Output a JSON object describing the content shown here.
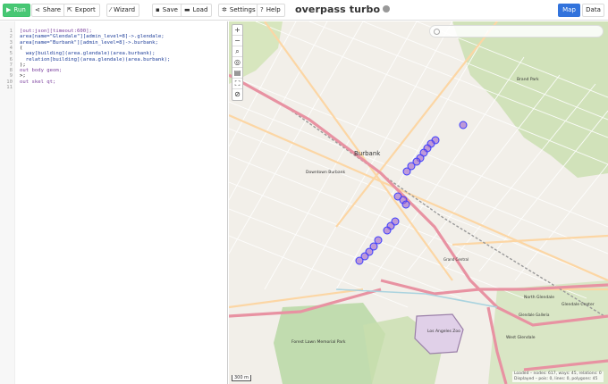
{
  "toolbar": {
    "run": "Run",
    "share": "Share",
    "export": "Export",
    "wizard": "Wizard",
    "save": "Save",
    "load": "Load",
    "settings": "Settings",
    "help": "Help",
    "brand": "overpass turbo",
    "tab_map": "Map",
    "tab_data": "Data"
  },
  "editor": {
    "lines": [
      {
        "n": "1",
        "text": "[out:json][timeout:600];"
      },
      {
        "n": "2",
        "text": "area[name=\"Glendale\"][admin_level=8]->.glendale;"
      },
      {
        "n": "3",
        "text": "area[name=\"Burbank\"][admin_level=8]->.burbank;"
      },
      {
        "n": "4",
        "text": "("
      },
      {
        "n": "5",
        "text": "  way[building](area.glendale)(area.burbank);"
      },
      {
        "n": "6",
        "text": "  relation[building](area.glendale)(area.burbank);"
      },
      {
        "n": "7",
        "text": ");"
      },
      {
        "n": "8",
        "text": "out body geom;"
      },
      {
        "n": "9",
        "text": ">;"
      },
      {
        "n": "10",
        "text": "out skel qt;"
      },
      {
        "n": "11",
        "text": ""
      }
    ]
  },
  "map": {
    "search_placeholder": "",
    "scale": "300 m",
    "status_line1": "Loaded – nodes: 617, ways: 45, relations: 0",
    "status_line2": "Displayed – pois: 0, lines: 0, polygons: 45",
    "labels": [
      {
        "text": "Burbank"
      },
      {
        "text": "Downtown Burbank"
      },
      {
        "text": "Los Angeles Zoo"
      },
      {
        "text": "Brand Park"
      },
      {
        "text": "Forest Lawn Memorial Park"
      },
      {
        "text": "North Glendale"
      },
      {
        "text": "Glendale Center"
      },
      {
        "text": "West Glendale"
      },
      {
        "text": "Grand Central"
      },
      {
        "text": "Glendale Galleria"
      }
    ]
  },
  "colors": {
    "run_green": "#48c774",
    "map_tab_blue": "#3273dc",
    "building_fill": "#9b5fcc",
    "building_stroke": "#3a3cff",
    "motorway": "#e892a2",
    "primary": "#fcd6a4",
    "park": "#add19e",
    "river": "#aad3df"
  }
}
